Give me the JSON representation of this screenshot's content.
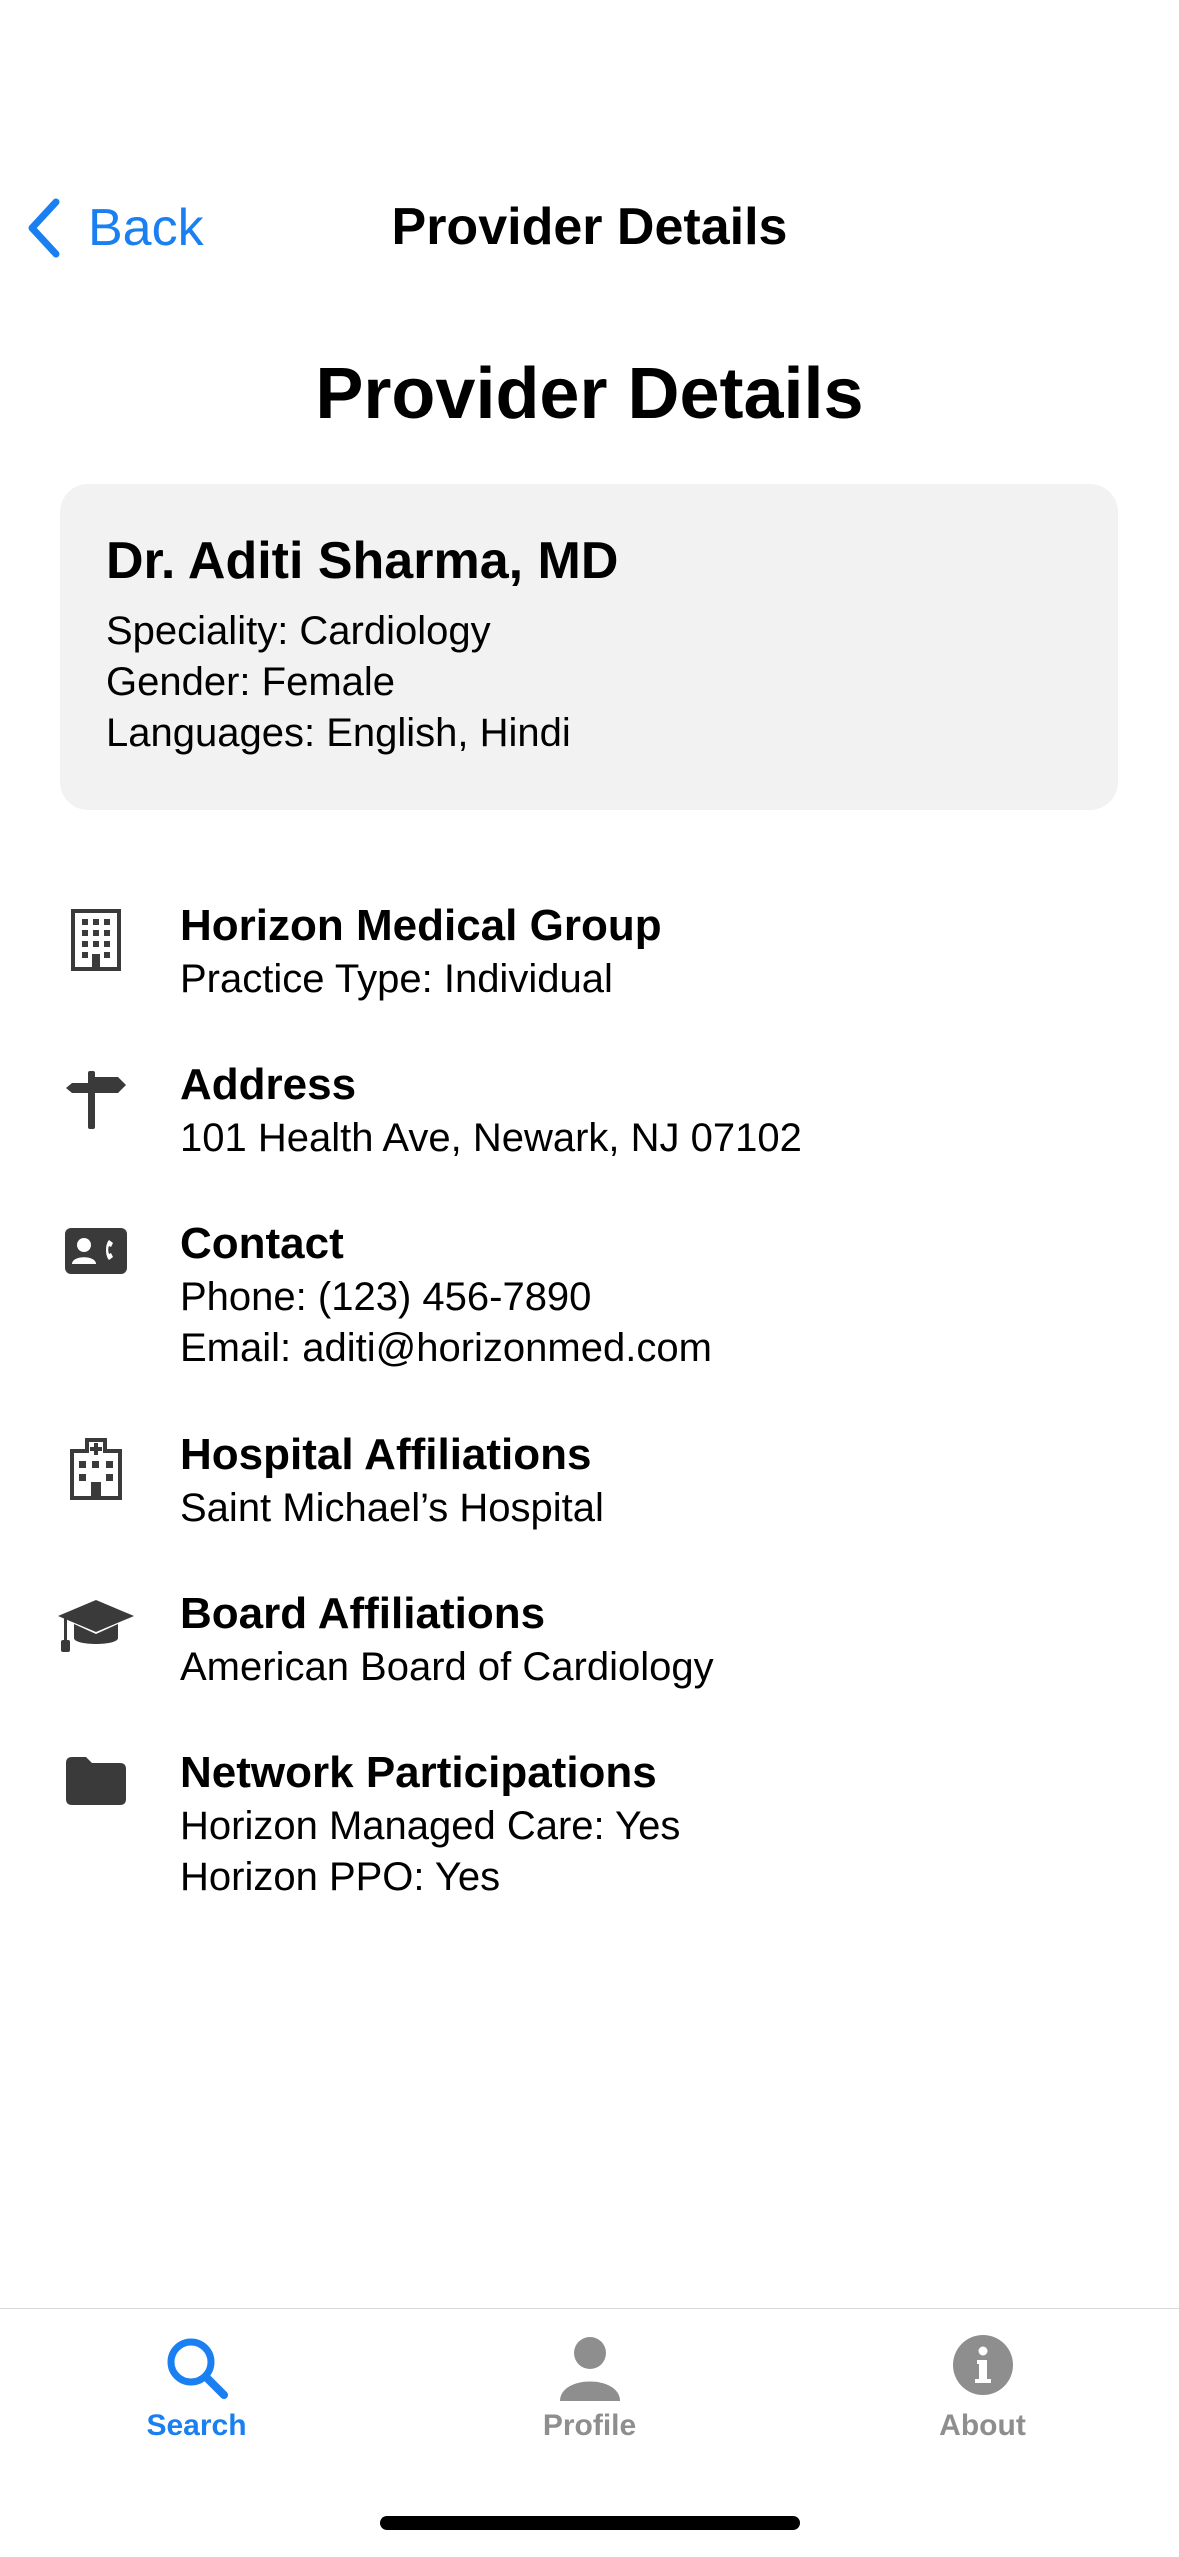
{
  "nav": {
    "back_label": "Back",
    "title": "Provider Details"
  },
  "page_title": "Provider Details",
  "provider": {
    "name": "Dr. Aditi Sharma, MD",
    "speciality": "Speciality: Cardiology",
    "gender": "Gender: Female",
    "languages": "Languages: English, Hindi"
  },
  "sections": [
    {
      "icon": "building-icon",
      "title": "Horizon Medical Group",
      "lines": [
        "Practice Type: Individual"
      ]
    },
    {
      "icon": "signpost-icon",
      "title": "Address",
      "lines": [
        "101 Health Ave, Newark, NJ 07102"
      ]
    },
    {
      "icon": "contact-card-icon",
      "title": "Contact",
      "lines": [
        "Phone: (123) 456-7890",
        "Email: aditi@horizonmed.com"
      ]
    },
    {
      "icon": "hospital-icon",
      "title": "Hospital Affiliations",
      "lines": [
        "Saint Michael’s Hospital"
      ]
    },
    {
      "icon": "graduation-cap-icon",
      "title": "Board Affiliations",
      "lines": [
        "American Board of Cardiology"
      ]
    },
    {
      "icon": "folder-icon",
      "title": "Network Participations",
      "lines": [
        "Horizon Managed Care: Yes",
        "Horizon PPO: Yes"
      ]
    }
  ],
  "tabs": [
    {
      "label": "Search",
      "icon": "search-icon",
      "active": true
    },
    {
      "label": "Profile",
      "icon": "person-icon",
      "active": false
    },
    {
      "label": "About",
      "icon": "info-icon",
      "active": false
    }
  ],
  "colors": {
    "accent": "#1a7ff0",
    "inactive_tab": "#8e8e8e",
    "icon": "#3a3a3a",
    "card_bg": "#f2f2f2"
  }
}
